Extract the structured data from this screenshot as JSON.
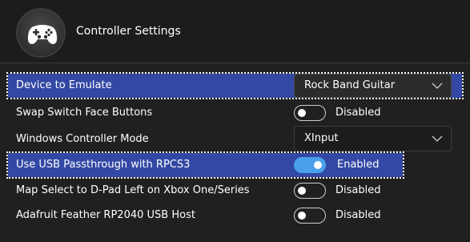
{
  "header": {
    "title": "Controller Settings",
    "icon": "gamepad-icon"
  },
  "settings": {
    "device": {
      "label": "Device to Emulate",
      "value": "Rock Band Guitar"
    },
    "swap": {
      "label": "Swap Switch Face Buttons",
      "state": "Disabled"
    },
    "windows_mode": {
      "label": "Windows Controller Mode",
      "value": "XInput"
    },
    "usb_passthrough": {
      "label": "Use USB Passthrough with RPCS3",
      "state": "Enabled"
    },
    "map_select": {
      "label": "Map Select to D-Pad Left on Xbox One/Series",
      "state": "Disabled"
    },
    "feather": {
      "label": "Adafruit Feather RP2040 USB Host",
      "state": "Disabled"
    }
  },
  "colors": {
    "highlight": "#3248a4",
    "toggle_on": "#4aa0ea",
    "background": "#202020"
  }
}
